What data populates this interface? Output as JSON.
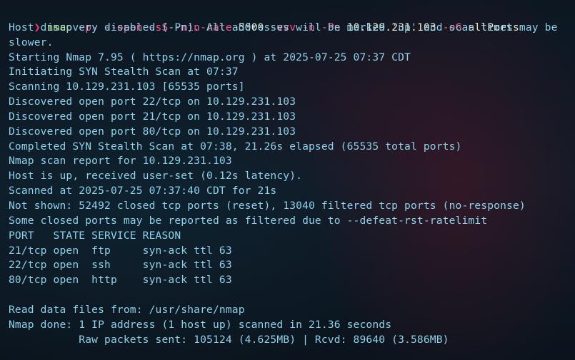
{
  "prompt": {
    "arrow": "❯",
    "command": "nmap",
    "args": [
      {
        "text": "-p-",
        "kind": "flag"
      },
      {
        "text": "--open",
        "kind": "flag"
      },
      {
        "text": "-sS",
        "kind": "flag"
      },
      {
        "text": "-min-rate",
        "kind": "flag"
      },
      {
        "text": "5000",
        "kind": "arg"
      },
      {
        "text": "-vvv",
        "kind": "flag"
      },
      {
        "text": "-n",
        "kind": "flag"
      },
      {
        "text": "-Pn",
        "kind": "flag"
      },
      {
        "text": "10.129.231.103",
        "kind": "arg"
      },
      {
        "text": "-oG",
        "kind": "flag"
      },
      {
        "text": "allPorts",
        "kind": "arg"
      }
    ]
  },
  "output": [
    "Host discovery disabled (-Pn). All addresses will be marked 'up' and scan times may be slower.",
    "Starting Nmap 7.95 ( https://nmap.org ) at 2025-07-25 07:37 CDT",
    "Initiating SYN Stealth Scan at 07:37",
    "Scanning 10.129.231.103 [65535 ports]",
    "Discovered open port 22/tcp on 10.129.231.103",
    "Discovered open port 21/tcp on 10.129.231.103",
    "Discovered open port 80/tcp on 10.129.231.103",
    "Completed SYN Stealth Scan at 07:38, 21.26s elapsed (65535 total ports)",
    "Nmap scan report for 10.129.231.103",
    "Host is up, received user-set (0.12s latency).",
    "Scanned at 2025-07-25 07:37:40 CDT for 21s",
    "Not shown: 52492 closed tcp ports (reset), 13040 filtered tcp ports (no-response)",
    "Some closed ports may be reported as filtered due to --defeat-rst-ratelimit",
    "PORT   STATE SERVICE REASON",
    "21/tcp open  ftp     syn-ack ttl 63",
    "22/tcp open  ssh     syn-ack ttl 63",
    "80/tcp open  http    syn-ack ttl 63",
    "",
    "Read data files from: /usr/share/nmap",
    "Nmap done: 1 IP address (1 host up) scanned in 21.36 seconds",
    "           Raw packets sent: 105124 (4.625MB) | Rcvd: 89640 (3.586MB)"
  ],
  "colors": {
    "background": "#0e1824",
    "output_text": "#8fd0ea",
    "prompt_arrow": "#ff3b6b",
    "command": "#b8e06a",
    "flag": "#ff5a8e",
    "argument": "#f0e6c8"
  }
}
